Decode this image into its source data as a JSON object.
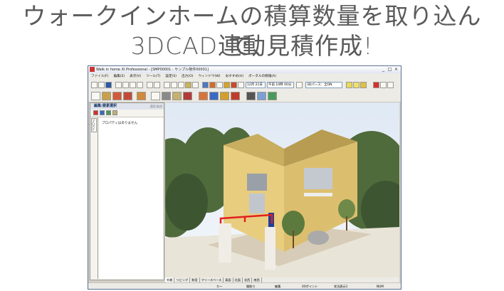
{
  "headline": {
    "line1": "ウォークインホームの積算数量を取り込んで、",
    "line2": "3DCAD連動見積作成!"
  },
  "window": {
    "title": "Walk in home XI Professional - [SMP00001 : サンプル物件00001]",
    "controls": [
      "_",
      "□",
      "×"
    ],
    "menu": [
      "ファイル(F)",
      "編集(E)",
      "表示(V)",
      "ツール(T)",
      "設定(S)",
      "出力(O)",
      "ウィンドウ(W)",
      "おすすめ(H)",
      "ポータルの情報(A)"
    ],
    "toolbar": {
      "date_value": "12月 21日",
      "time_value": "午前 10時 00分",
      "render_value": "3Dパース：全ON"
    },
    "left_panel": {
      "title": "編集:要素選択",
      "buttons": [
        "適用",
        "取消"
      ],
      "tab_label": "プロパティ",
      "message": "プロパティはありません"
    },
    "view_tabs": [
      "外観",
      "リビング",
      "和室",
      "フリースペース",
      "東面",
      "北面",
      "北西",
      "南西"
    ],
    "active_view_tab": "外観",
    "status": [
      "カー",
      "間取り",
      "編集",
      "XXポイント",
      "状況表示1",
      "NUM"
    ]
  },
  "colors": {
    "sky_top": "#dfe9f4",
    "wall": "#e8cd7e",
    "trees": "#4f6b3c",
    "red_frame": "#e22020",
    "headline": "#5a5a5a"
  }
}
